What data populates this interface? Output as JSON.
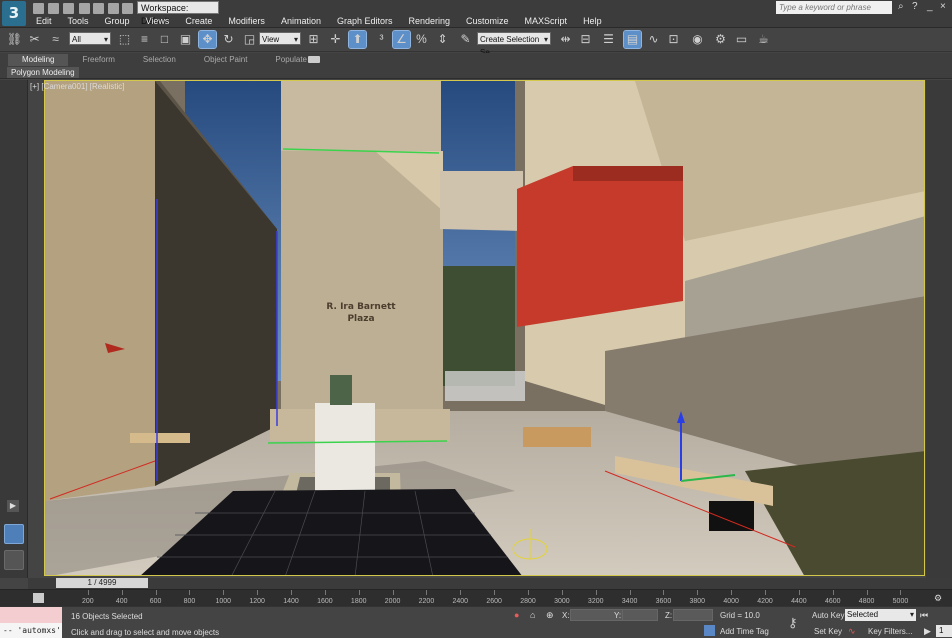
{
  "app": {
    "logo_glyph": "3",
    "workspace": "Workspace: Default",
    "search_placeholder": "Type a keyword or phrase"
  },
  "menu": [
    "Edit",
    "Tools",
    "Group",
    "Views",
    "Create",
    "Modifiers",
    "Animation",
    "Graph Editors",
    "Rendering",
    "Customize",
    "MAXScript",
    "Help"
  ],
  "toolbar": {
    "selection_filter": "All",
    "reference_coord": "View",
    "named_selection": "Create Selection Se"
  },
  "ribbon": {
    "tabs": [
      "Modeling",
      "Freeform",
      "Selection",
      "Object Paint",
      "Populate"
    ],
    "selected_tab": "Modeling",
    "sub_tab": "Polygon Modeling"
  },
  "viewport": {
    "label": "[+] [Camera001] [Realistic]",
    "sign_line1": "R. Ira Barnett",
    "sign_line2": "Plaza"
  },
  "time_slider": {
    "frame": "1 / 4999"
  },
  "track": {
    "ticks": [
      "200",
      "400",
      "600",
      "800",
      "1000",
      "1200",
      "1400",
      "1600",
      "1800",
      "2000",
      "2200",
      "2400",
      "2600",
      "2800",
      "3000",
      "3200",
      "3400",
      "3600",
      "3800",
      "4000",
      "4200",
      "4400",
      "4600",
      "4800",
      "5000"
    ]
  },
  "status": {
    "maxscript_input": "-- 'automxs'",
    "objects_selected": "16 Objects Selected",
    "prompt": "Click and drag to select and move objects",
    "x_label": "X:",
    "y_label": "Y:",
    "z_label": "Z:",
    "grid": "Grid = 10.0",
    "add_time_tag": "Add Time Tag",
    "auto_key": "Auto Key",
    "set_key": "Set Key",
    "key_mode": "Selected",
    "key_filters": "Key Filters...",
    "frame_value": "1"
  }
}
